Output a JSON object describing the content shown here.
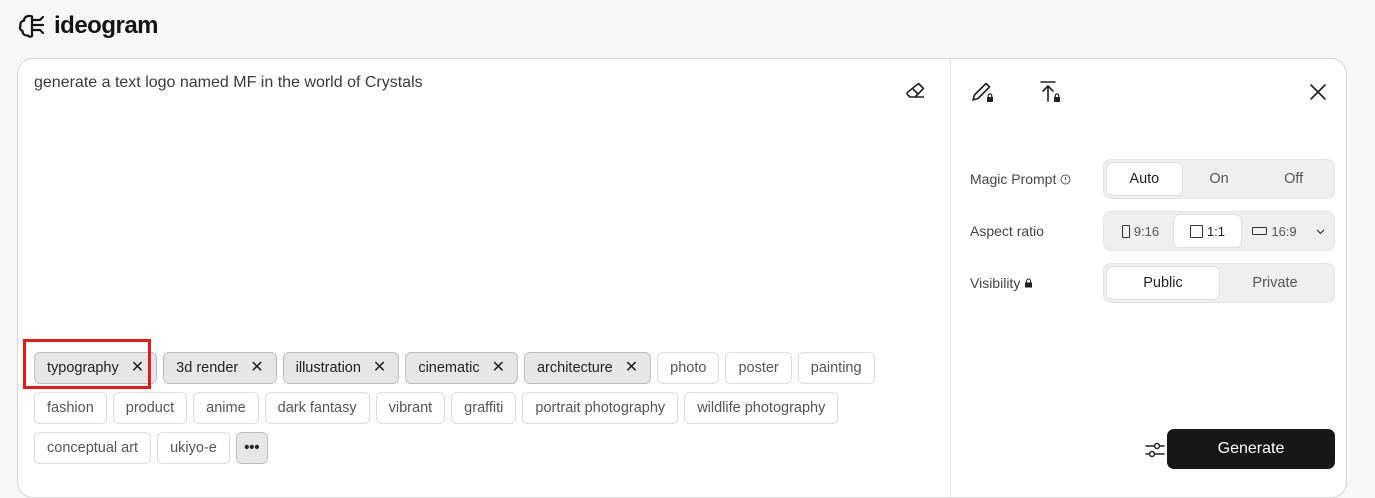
{
  "brand": {
    "name": "ideogram",
    "logo_icon": "ideogram-brain-icon"
  },
  "prompt": {
    "text": "generate a text logo named MF in the world of Crystals"
  },
  "style_tags": {
    "row1": [
      {
        "label": "typography",
        "selected": true
      },
      {
        "label": "3d render",
        "selected": true
      },
      {
        "label": "illustration",
        "selected": true
      },
      {
        "label": "cinematic",
        "selected": true
      },
      {
        "label": "architecture",
        "selected": true
      },
      {
        "label": "photo",
        "selected": false
      },
      {
        "label": "poster",
        "selected": false
      },
      {
        "label": "painting",
        "selected": false
      }
    ],
    "row2": [
      {
        "label": "fashion"
      },
      {
        "label": "product"
      },
      {
        "label": "anime"
      },
      {
        "label": "dark fantasy"
      },
      {
        "label": "vibrant"
      },
      {
        "label": "graffiti"
      },
      {
        "label": "portrait photography"
      },
      {
        "label": "wildlife photography"
      }
    ],
    "row3": [
      {
        "label": "conceptual art"
      },
      {
        "label": "ukiyo-e"
      }
    ],
    "more_label": "•••",
    "remove_glyph": "✕"
  },
  "settings": {
    "magic_prompt": {
      "label": "Magic Prompt",
      "options": [
        "Auto",
        "On",
        "Off"
      ],
      "selected": "Auto"
    },
    "aspect_ratio": {
      "label": "Aspect ratio",
      "options": [
        "9:16",
        "1:1",
        "16:9"
      ],
      "selected": "1:1"
    },
    "visibility": {
      "label": "Visibility",
      "options": [
        "Public",
        "Private"
      ],
      "selected": "Public"
    }
  },
  "actions": {
    "generate_label": "Generate"
  },
  "colors": {
    "accent": "#171717",
    "highlight": "#e01b1b"
  }
}
